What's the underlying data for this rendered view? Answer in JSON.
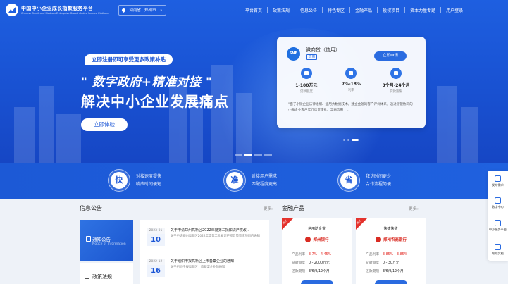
{
  "header": {
    "logo_title": "中国中小企业成长指数服务平台",
    "logo_subtitle": "Chinese Small and Medium Enterprise Growth Index Service Platform",
    "location": {
      "province": "河南省",
      "city": "郑州市"
    },
    "nav": [
      "平台首页",
      "政策法规",
      "信息公告",
      "特色专区",
      "金融产品",
      "投权项目",
      "资本力量专题",
      "用户登录"
    ]
  },
  "hero": {
    "promo_tag": "立即注册即可享受更多政策补贴",
    "headline_1": "\" 数字政府+精准对接 \"",
    "headline_2": "解决中小企业发展痛点",
    "cta": "立即体验"
  },
  "product_card": {
    "bank_abbr": "SNB",
    "name": "微商贷（信用）",
    "tag": "信用",
    "apply_label": "立即申请",
    "stats": [
      {
        "icon": "money-bag-icon",
        "value": "1-100万元",
        "label": "贷款额度"
      },
      {
        "icon": "percent-icon",
        "value": "7%-18%",
        "label": "利率"
      },
      {
        "icon": "calendar-icon",
        "value": "3个月-24个月",
        "label": "贷款期限"
      }
    ],
    "description": "\"面子小微企业法律组织、运用大数据技术，建立金融的客户评价体系，通过银银协同的小微企业客户实行信贷审批、工商信用上..."
  },
  "features": [
    {
      "char": "快",
      "line1": "对接速度提快",
      "line2": "响应时间便短"
    },
    {
      "char": "准",
      "line1": "对接用户需求",
      "line2": "匹配程度更高"
    },
    {
      "char": "省",
      "line1": "拜访时间更少",
      "line2": "合作流程简便"
    }
  ],
  "info_section": {
    "title": "信息公告",
    "more": "更多»",
    "notice_label": "通知公告",
    "notice_sub": "Notice of Information",
    "policy_label": "政策法规",
    "items": [
      {
        "ym": "2023-01",
        "day": "10",
        "title": "关于申请郑州高新区2022年度第二批知识产权政...",
        "desc": "关于申请郑州高新区2022年度第二批知识产权政策资金项目的通知"
      },
      {
        "ym": "2022-12",
        "day": "16",
        "title": "关于组织申报高新区上市备案企业的通知",
        "desc": "关于组织申报高新区上市备案企业的通知"
      }
    ]
  },
  "finance_section": {
    "title": "金融产品",
    "more": "更多»",
    "cards": [
      {
        "ribbon": "推荐",
        "title": "信用助企贷",
        "bank": "郑州银行",
        "rate_label": "产品利率：",
        "rate": "3.7% - 4.45%",
        "amount_label": "贷款额度：",
        "amount": "0 - 2000万元",
        "term_label": "还款期限：",
        "term": "3/6/9/12个月"
      },
      {
        "ribbon": "推荐",
        "title": "快捷快贷",
        "bank": "郑州农商银行",
        "rate_label": "产品利率：",
        "rate": "3.85% - 3.85%",
        "amount_label": "贷款额度：",
        "amount": "0 - 30万元",
        "term_label": "还款期限：",
        "term": "3/6/9/12个月"
      }
    ]
  },
  "sidebar": [
    {
      "icon": "publish-demand-icon",
      "label": "发布需求"
    },
    {
      "icon": "recommend-icon",
      "label": "数字中心"
    },
    {
      "icon": "service-icon",
      "label": "中小服务平台"
    },
    {
      "icon": "doc-icon",
      "label": "帮助文档"
    }
  ],
  "colors": {
    "primary": "#1a55d6",
    "accent_red": "#e4322c"
  }
}
